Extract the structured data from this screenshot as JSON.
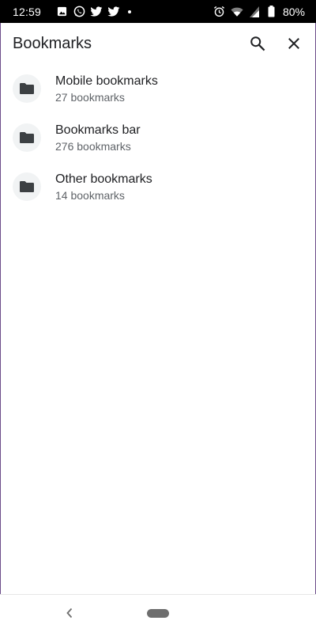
{
  "status_bar": {
    "time": "12:59",
    "battery": "80%",
    "left_icons": [
      "image-icon",
      "whatsapp-icon",
      "twitter-icon",
      "twitter-icon",
      "dot-icon"
    ],
    "right_icons": [
      "alarm-icon",
      "wifi-icon",
      "signal-icon",
      "battery-icon"
    ]
  },
  "app_bar": {
    "title": "Bookmarks",
    "actions": [
      "search-icon",
      "close-icon"
    ]
  },
  "folders": [
    {
      "title": "Mobile bookmarks",
      "subtitle": "27 bookmarks",
      "icon": "folder-icon"
    },
    {
      "title": "Bookmarks bar",
      "subtitle": "276 bookmarks",
      "icon": "folder-icon"
    },
    {
      "title": "Other bookmarks",
      "subtitle": "14 bookmarks",
      "icon": "folder-icon"
    }
  ],
  "nav_bar": {
    "buttons": [
      "back-icon",
      "home-pill"
    ]
  },
  "colors": {
    "text_primary": "#202124",
    "text_secondary": "#5f6368",
    "avatar_bg": "#f1f3f4",
    "icon": "#3c4043"
  }
}
